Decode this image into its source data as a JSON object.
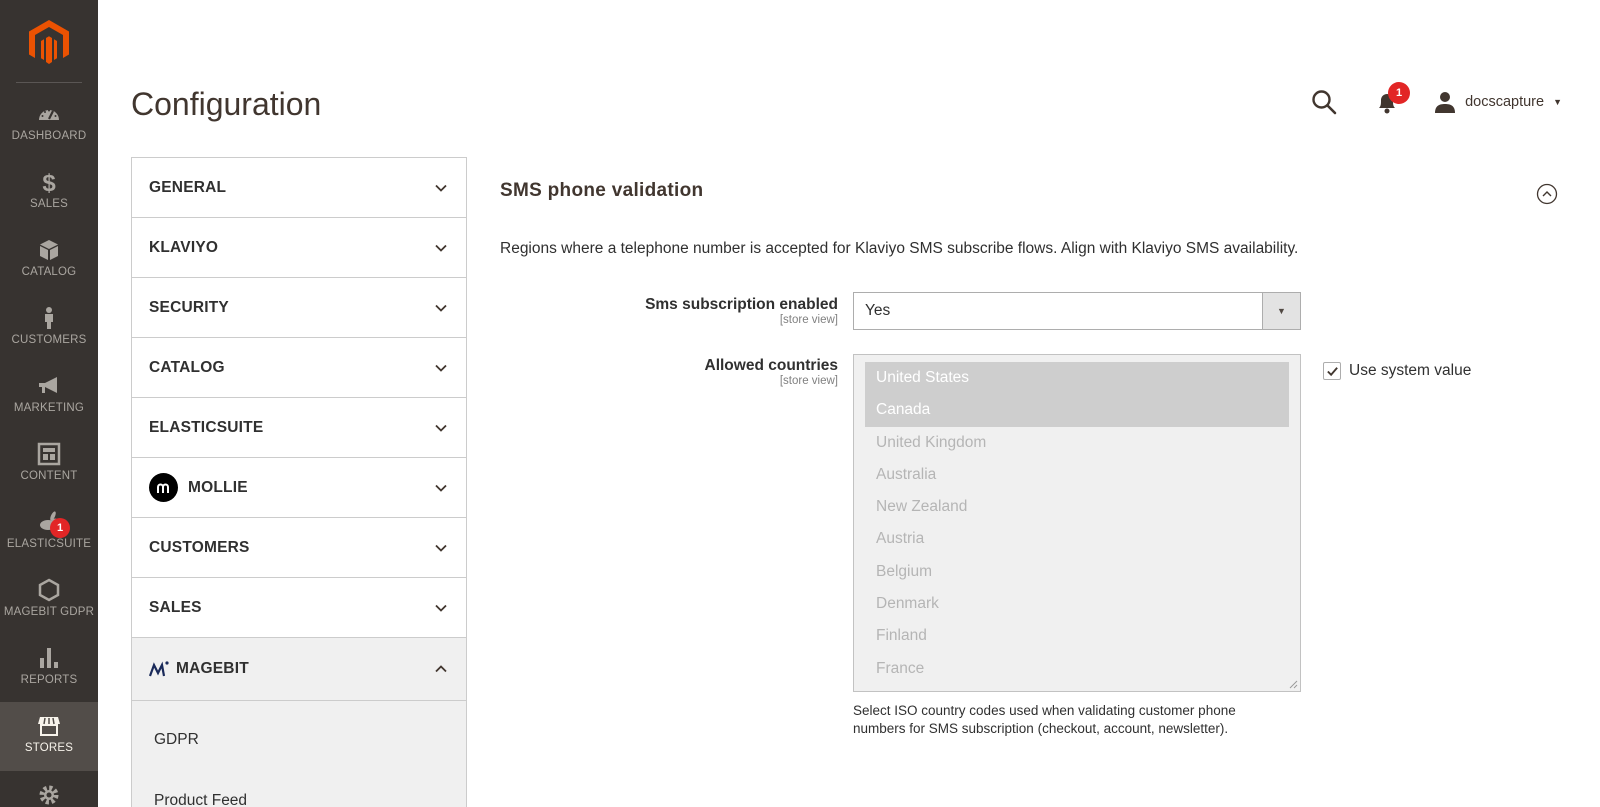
{
  "header": {
    "page_title": "Configuration",
    "notification_count": "1",
    "username": "docscapture"
  },
  "nav": {
    "items": [
      {
        "label": "DASHBOARD",
        "icon": "dashboard-icon"
      },
      {
        "label": "SALES",
        "icon": "dollar-icon"
      },
      {
        "label": "CATALOG",
        "icon": "box-icon"
      },
      {
        "label": "CUSTOMERS",
        "icon": "person-icon"
      },
      {
        "label": "MARKETING",
        "icon": "megaphone-icon"
      },
      {
        "label": "CONTENT",
        "icon": "layout-icon"
      },
      {
        "label": "ELASTICSUITE",
        "icon": "rabbit-icon",
        "badge": "1"
      },
      {
        "label": "MAGEBIT GDPR",
        "icon": "hexagon-icon"
      },
      {
        "label": "REPORTS",
        "icon": "bar-chart-icon"
      },
      {
        "label": "STORES",
        "icon": "store-icon",
        "active": true
      }
    ]
  },
  "tabs": {
    "items": [
      {
        "label": "GENERAL"
      },
      {
        "label": "KLAVIYO"
      },
      {
        "label": "SECURITY"
      },
      {
        "label": "CATALOG"
      },
      {
        "label": "ELASTICSUITE"
      },
      {
        "label": "MOLLIE"
      },
      {
        "label": "CUSTOMERS"
      },
      {
        "label": "SALES"
      },
      {
        "label": "MAGEBIT"
      }
    ],
    "subitems": [
      "GDPR",
      "Product Feed"
    ]
  },
  "section": {
    "title": "SMS phone validation",
    "comment": "Regions where a telephone number is accepted for Klaviyo SMS subscribe flows. Align with Klaviyo SMS availability.",
    "sms_enabled": {
      "label": "Sms subscription enabled",
      "scope": "[store view]",
      "value": "Yes"
    },
    "allowed_countries": {
      "label": "Allowed countries",
      "scope": "[store view]",
      "options": [
        {
          "name": "United States",
          "selected": true
        },
        {
          "name": "Canada",
          "selected": true
        },
        {
          "name": "United Kingdom",
          "selected": false
        },
        {
          "name": "Australia",
          "selected": false
        },
        {
          "name": "New Zealand",
          "selected": false
        },
        {
          "name": "Austria",
          "selected": false
        },
        {
          "name": "Belgium",
          "selected": false
        },
        {
          "name": "Denmark",
          "selected": false
        },
        {
          "name": "Finland",
          "selected": false
        },
        {
          "name": "France",
          "selected": false
        }
      ],
      "use_system_value_label": "Use system value",
      "use_system_value_checked": true,
      "note": "Select ISO country codes used when validating customer phone numbers for SMS subscription (checkout, account, newsletter)."
    }
  },
  "colors": {
    "nav_bg": "#373330",
    "nav_active": "#524d49",
    "badge": "#e22626",
    "logo": "#eb5202"
  }
}
